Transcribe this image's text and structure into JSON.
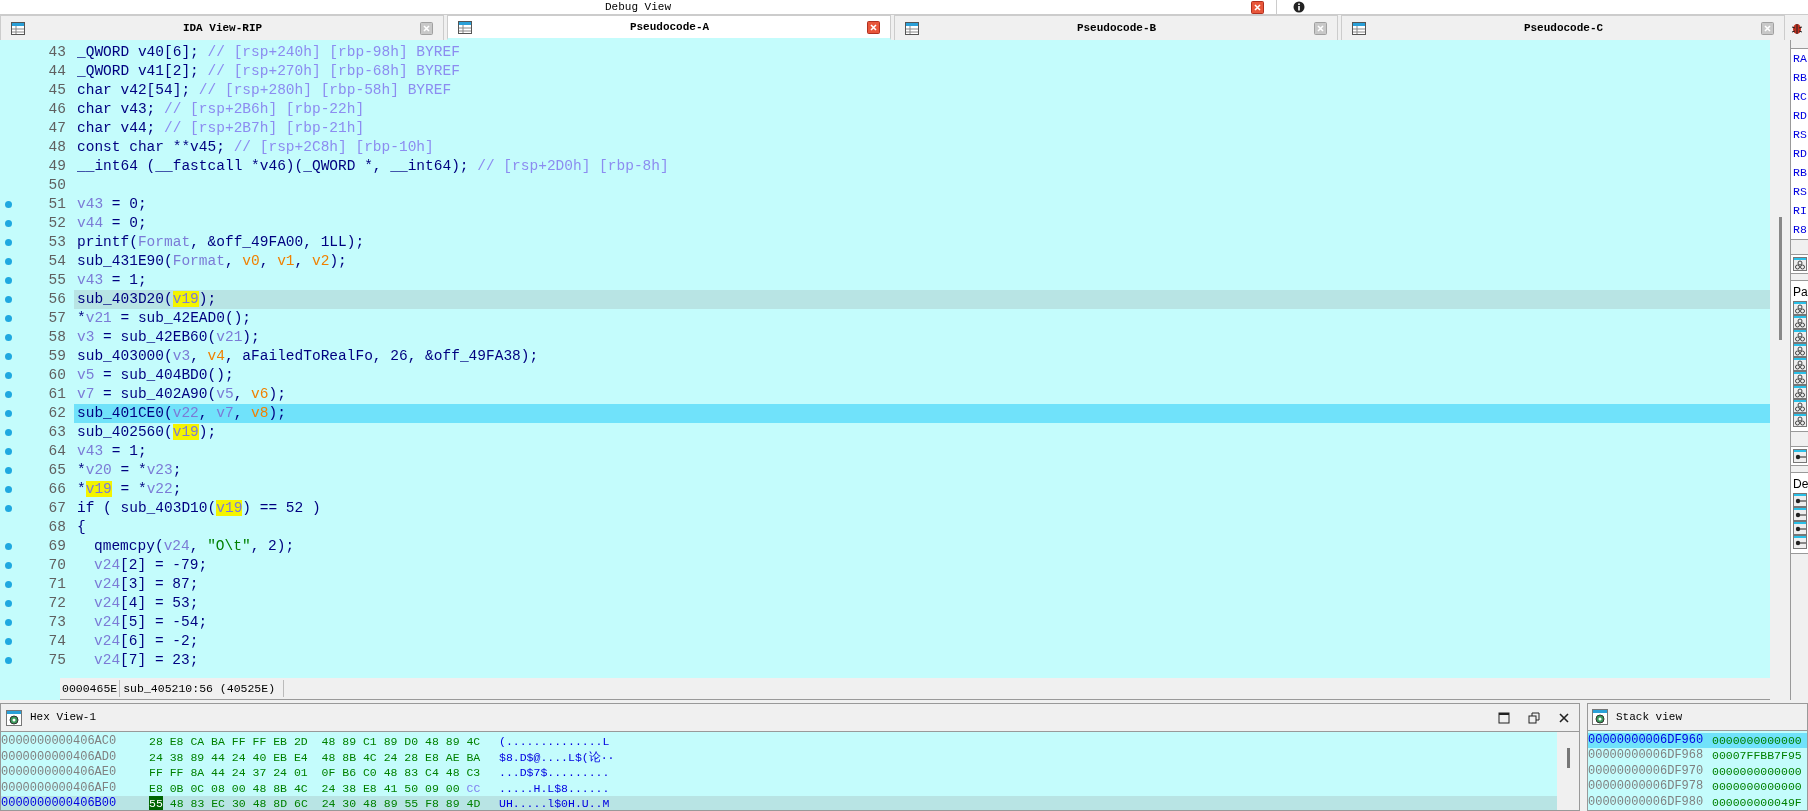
{
  "top_bar": {
    "title": "Debug View"
  },
  "tabs": [
    {
      "label": "IDA View-RIP",
      "selected": false
    },
    {
      "label": "Pseudocode-A",
      "selected": true
    },
    {
      "label": "Pseudocode-B",
      "selected": false
    },
    {
      "label": "Pseudocode-C",
      "selected": false
    }
  ],
  "code": {
    "lines": [
      {
        "number": "43",
        "breakpoint": false,
        "cursor": false,
        "selected": false,
        "nested": false,
        "segments": [
          {
            "kind": "plain",
            "t": "_QWORD v40[6]; "
          },
          {
            "kind": "comment",
            "t": "// [rsp+240h] [rbp-98h] BYREF"
          }
        ]
      },
      {
        "number": "44",
        "breakpoint": false,
        "cursor": false,
        "selected": false,
        "nested": false,
        "segments": [
          {
            "kind": "plain",
            "t": "_QWORD v41[2]; "
          },
          {
            "kind": "comment",
            "t": "// [rsp+270h] [rbp-68h] BYREF"
          }
        ]
      },
      {
        "number": "45",
        "breakpoint": false,
        "cursor": false,
        "selected": false,
        "nested": false,
        "segments": [
          {
            "kind": "plain",
            "t": "char v42[54]; "
          },
          {
            "kind": "comment",
            "t": "// [rsp+280h] [rbp-58h] BYREF"
          }
        ]
      },
      {
        "number": "46",
        "breakpoint": false,
        "cursor": false,
        "selected": false,
        "nested": false,
        "segments": [
          {
            "kind": "plain",
            "t": "char v43; "
          },
          {
            "kind": "comment",
            "t": "// [rsp+2B6h] [rbp-22h]"
          }
        ]
      },
      {
        "number": "47",
        "breakpoint": false,
        "cursor": false,
        "selected": false,
        "nested": false,
        "segments": [
          {
            "kind": "plain",
            "t": "char v44; "
          },
          {
            "kind": "comment",
            "t": "// [rsp+2B7h] [rbp-21h]"
          }
        ]
      },
      {
        "number": "48",
        "breakpoint": false,
        "cursor": false,
        "selected": false,
        "nested": false,
        "segments": [
          {
            "kind": "plain",
            "t": "const char **v45; "
          },
          {
            "kind": "comment",
            "t": "// [rsp+2C8h] [rbp-10h]"
          }
        ]
      },
      {
        "number": "49",
        "breakpoint": false,
        "cursor": false,
        "selected": false,
        "nested": false,
        "segments": [
          {
            "kind": "plain",
            "t": "__int64 (__fastcall *v46)(_QWORD *, __int64); "
          },
          {
            "kind": "comment",
            "t": "// [rsp+2D0h] [rbp-8h]"
          }
        ]
      },
      {
        "number": "50",
        "breakpoint": false,
        "cursor": false,
        "selected": false
      },
      {
        "number": "51",
        "breakpoint": true,
        "cursor": false,
        "selected": false,
        "nested": false,
        "segments": [
          {
            "kind": "var",
            "t": "v43"
          },
          {
            "kind": "plain",
            "t": " = 0;"
          }
        ]
      },
      {
        "number": "52",
        "breakpoint": true,
        "cursor": false,
        "selected": false,
        "nested": false,
        "segments": [
          {
            "kind": "var",
            "t": "v44"
          },
          {
            "kind": "plain",
            "t": " = 0;"
          }
        ]
      },
      {
        "number": "53",
        "breakpoint": true,
        "cursor": false,
        "selected": false,
        "nested": false,
        "segments": [
          {
            "kind": "plain",
            "t": "printf("
          },
          {
            "kind": "var",
            "t": "Format"
          },
          {
            "kind": "plain",
            "t": ", &off_49FA00, 1LL);"
          }
        ]
      },
      {
        "number": "54",
        "breakpoint": true,
        "cursor": false,
        "selected": false,
        "nested": false,
        "segments": [
          {
            "kind": "plain",
            "t": "sub_431E90("
          },
          {
            "kind": "var",
            "t": "Format"
          },
          {
            "kind": "plain",
            "t": ", "
          },
          {
            "kind": "arg",
            "t": "v0"
          },
          {
            "kind": "plain",
            "t": ", "
          },
          {
            "kind": "arg",
            "t": "v1"
          },
          {
            "kind": "plain",
            "t": ", "
          },
          {
            "kind": "arg",
            "t": "v2"
          },
          {
            "kind": "plain",
            "t": ");"
          }
        ]
      },
      {
        "number": "55",
        "breakpoint": true,
        "cursor": false,
        "selected": false,
        "nested": false,
        "segments": [
          {
            "kind": "var",
            "t": "v43"
          },
          {
            "kind": "plain",
            "t": " = 1;"
          }
        ]
      },
      {
        "number": "56",
        "breakpoint": true,
        "cursor": true,
        "selected": false,
        "nested": false,
        "segments": [
          {
            "kind": "plain",
            "t": "sub_403D20("
          },
          {
            "kind": "highlighted",
            "t": "v19"
          },
          {
            "kind": "plain",
            "t": ");"
          }
        ]
      },
      {
        "number": "57",
        "breakpoint": true,
        "cursor": false,
        "selected": false,
        "nested": false,
        "segments": [
          {
            "kind": "plain",
            "t": "*"
          },
          {
            "kind": "var",
            "t": "v21"
          },
          {
            "kind": "plain",
            "t": " = sub_42EAD0();"
          }
        ]
      },
      {
        "number": "58",
        "breakpoint": true,
        "cursor": false,
        "selected": false,
        "nested": false,
        "segments": [
          {
            "kind": "var",
            "t": "v3"
          },
          {
            "kind": "plain",
            "t": " = sub_42EB60("
          },
          {
            "kind": "var",
            "t": "v21"
          },
          {
            "kind": "plain",
            "t": ");"
          }
        ]
      },
      {
        "number": "59",
        "breakpoint": true,
        "cursor": false,
        "selected": false,
        "nested": false,
        "segments": [
          {
            "kind": "plain",
            "t": "sub_403000("
          },
          {
            "kind": "var",
            "t": "v3"
          },
          {
            "kind": "plain",
            "t": ", "
          },
          {
            "kind": "arg",
            "t": "v4"
          },
          {
            "kind": "plain",
            "t": ", aFailedToRealFo, 26, &off_49FA38);"
          }
        ]
      },
      {
        "number": "60",
        "breakpoint": true,
        "cursor": false,
        "selected": false,
        "nested": false,
        "segments": [
          {
            "kind": "var",
            "t": "v5"
          },
          {
            "kind": "plain",
            "t": " = sub_404BD0();"
          }
        ]
      },
      {
        "number": "61",
        "breakpoint": true,
        "cursor": false,
        "selected": false,
        "nested": false,
        "segments": [
          {
            "kind": "var",
            "t": "v7"
          },
          {
            "kind": "plain",
            "t": " = sub_402A90("
          },
          {
            "kind": "var",
            "t": "v5"
          },
          {
            "kind": "plain",
            "t": ", "
          },
          {
            "kind": "arg",
            "t": "v6"
          },
          {
            "kind": "plain",
            "t": ");"
          }
        ]
      },
      {
        "number": "62",
        "breakpoint": true,
        "cursor": false,
        "selected": true,
        "nested": false,
        "segments": [
          {
            "kind": "plain",
            "t": "sub_401CE0("
          },
          {
            "kind": "var",
            "t": "v22"
          },
          {
            "kind": "plain",
            "t": ", "
          },
          {
            "kind": "var",
            "t": "v7"
          },
          {
            "kind": "plain",
            "t": ", "
          },
          {
            "kind": "arg",
            "t": "v8"
          },
          {
            "kind": "plain",
            "t": ");"
          }
        ]
      },
      {
        "number": "63",
        "breakpoint": true,
        "cursor": false,
        "selected": false,
        "nested": false,
        "segments": [
          {
            "kind": "plain",
            "t": "sub_402560("
          },
          {
            "kind": "highlighted",
            "t": "v19"
          },
          {
            "kind": "plain",
            "t": ");"
          }
        ]
      },
      {
        "number": "64",
        "breakpoint": true,
        "cursor": false,
        "selected": false,
        "nested": false,
        "segments": [
          {
            "kind": "var",
            "t": "v43"
          },
          {
            "kind": "plain",
            "t": " = 1;"
          }
        ]
      },
      {
        "number": "65",
        "breakpoint": true,
        "cursor": false,
        "selected": false,
        "nested": false,
        "segments": [
          {
            "kind": "plain",
            "t": "*"
          },
          {
            "kind": "var",
            "t": "v20"
          },
          {
            "kind": "plain",
            "t": " = *"
          },
          {
            "kind": "var",
            "t": "v23"
          },
          {
            "kind": "plain",
            "t": ";"
          }
        ]
      },
      {
        "number": "66",
        "breakpoint": true,
        "cursor": false,
        "selected": false,
        "nested": false,
        "segments": [
          {
            "kind": "plain",
            "t": "*"
          },
          {
            "kind": "highlighted",
            "t": "v19"
          },
          {
            "kind": "plain",
            "t": " = *"
          },
          {
            "kind": "var",
            "t": "v22"
          },
          {
            "kind": "plain",
            "t": ";"
          }
        ]
      },
      {
        "number": "67",
        "breakpoint": true,
        "cursor": false,
        "selected": false,
        "nested": false,
        "segments": [
          {
            "kind": "plain",
            "t": "if ( sub_403D10("
          },
          {
            "kind": "highlighted",
            "t": "v19"
          },
          {
            "kind": "plain",
            "t": ") == 52 )"
          }
        ]
      },
      {
        "number": "68",
        "breakpoint": false,
        "cursor": false,
        "selected": false,
        "nested": false,
        "segments": [
          {
            "kind": "plain",
            "t": "{"
          }
        ]
      },
      {
        "number": "69",
        "breakpoint": true,
        "cursor": false,
        "selected": false,
        "nested": true,
        "segments": [
          {
            "kind": "plain",
            "t": "qmemcpy("
          },
          {
            "kind": "var",
            "t": "v24"
          },
          {
            "kind": "plain",
            "t": ", "
          },
          {
            "kind": "string",
            "t": "\"O\\t\""
          },
          {
            "kind": "plain",
            "t": ", 2);"
          }
        ]
      },
      {
        "number": "70",
        "breakpoint": true,
        "cursor": false,
        "selected": false,
        "nested": true,
        "segments": [
          {
            "kind": "var",
            "t": "v24"
          },
          {
            "kind": "plain",
            "t": "[2] = -79;"
          }
        ]
      },
      {
        "number": "71",
        "breakpoint": true,
        "cursor": false,
        "selected": false,
        "nested": true,
        "segments": [
          {
            "kind": "var",
            "t": "v24"
          },
          {
            "kind": "plain",
            "t": "[3] = 87;"
          }
        ]
      },
      {
        "number": "72",
        "breakpoint": true,
        "cursor": false,
        "selected": false,
        "nested": true,
        "segments": [
          {
            "kind": "var",
            "t": "v24"
          },
          {
            "kind": "plain",
            "t": "[4] = 53;"
          }
        ]
      },
      {
        "number": "73",
        "breakpoint": true,
        "cursor": false,
        "selected": false,
        "nested": true,
        "segments": [
          {
            "kind": "var",
            "t": "v24"
          },
          {
            "kind": "plain",
            "t": "[5] = -54;"
          }
        ]
      },
      {
        "number": "74",
        "breakpoint": true,
        "cursor": false,
        "selected": false,
        "nested": true,
        "segments": [
          {
            "kind": "var",
            "t": "v24"
          },
          {
            "kind": "plain",
            "t": "[6] = -2;"
          }
        ]
      },
      {
        "number": "75",
        "breakpoint": true,
        "cursor": false,
        "selected": false,
        "nested": true,
        "segments": [
          {
            "kind": "var",
            "t": "v24"
          },
          {
            "kind": "plain",
            "t": "[7] = 23;"
          }
        ]
      }
    ]
  },
  "status_bar": {
    "address": "0000465E",
    "location": "sub_405210:56 (40525E)"
  },
  "registers": [
    "RA",
    "RB",
    "RC",
    "RD",
    "RS",
    "RD",
    "RB",
    "RS",
    "RI",
    "R8"
  ],
  "side_panels": [
    {
      "label": "Pa"
    },
    {
      "label": "De"
    }
  ],
  "hex_view": {
    "title": "Hex View-1",
    "rows": [
      {
        "address": "0000000000406AC0",
        "selected": false,
        "bytes": [
          {
            "kind": "hex",
            "t": "28 E8 CA BA FF FF EB 2D  48 89 C1 89 D0 48 89 4C"
          }
        ],
        "ascii": "(..............L"
      },
      {
        "address": "0000000000406AD0",
        "selected": false,
        "bytes": [
          {
            "kind": "hex",
            "t": "24 38 89 44 24 40 EB E4  48 8B 4C 24 28 E8 AE BA"
          }
        ],
        "ascii": "$8.D$@....L$(论··"
      },
      {
        "address": "0000000000406AE0",
        "selected": false,
        "bytes": [
          {
            "kind": "hex",
            "t": "FF FF 8A 44 24 37 24 01  0F B6 C0 48 83 C4 48 C3"
          }
        ],
        "ascii": "...D$7$........."
      },
      {
        "address": "0000000000406AF0",
        "selected": false,
        "bytes": [
          {
            "kind": "hex",
            "t": "E8 0B 0C 08 00 48 8B 4C  24 38 E8 41 50 09 00"
          },
          {
            "kind": "padding",
            "t": "CC"
          }
        ],
        "ascii": ".....H.L$8......"
      },
      {
        "address": "0000000000406B00",
        "selected": true,
        "bytes": [
          {
            "kind": "cursor",
            "t": "55"
          },
          {
            "kind": "hex",
            "t": "48 83 EC 30 48 8D 6C  24 30 48 89 55 F8 89 4D"
          }
        ],
        "ascii": "UH.....l$0H.U..M"
      }
    ]
  },
  "stack_view": {
    "title": "Stack view",
    "rows": [
      {
        "address": "00000000006DF960",
        "value": "0000000000000",
        "selected": true
      },
      {
        "address": "00000000006DF968",
        "value": "00007FFBB7F95",
        "selected": false
      },
      {
        "address": "00000000006DF970",
        "value": "0000000000000",
        "selected": false
      },
      {
        "address": "00000000006DF978",
        "value": "0000000000000",
        "selected": false
      },
      {
        "address": "00000000006DF980",
        "value": "000000000049F",
        "selected": false
      }
    ]
  }
}
